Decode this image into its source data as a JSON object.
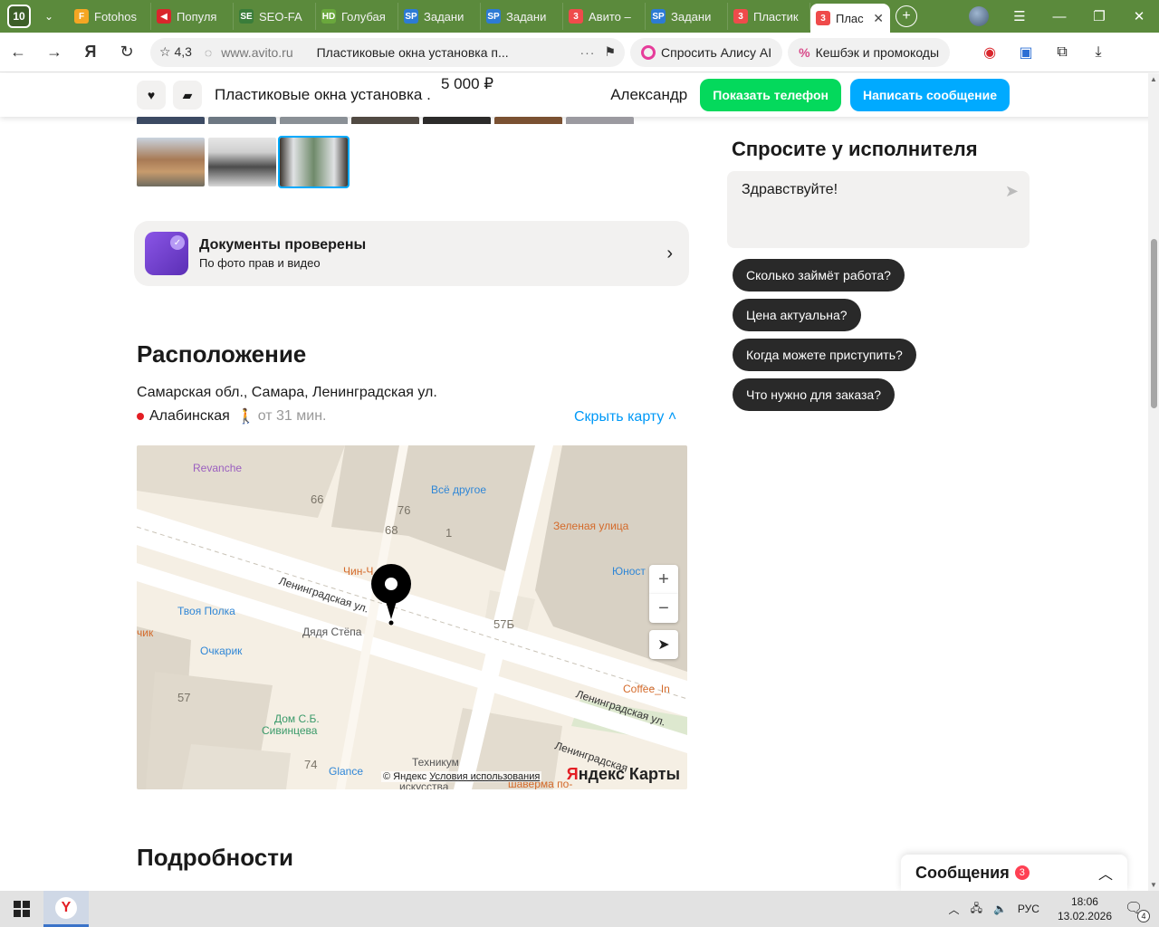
{
  "browser": {
    "tab_counter": "10",
    "tabs": [
      {
        "title": "Fotohos",
        "icon": "F",
        "color": "#f5a623"
      },
      {
        "title": "Популя",
        "icon": "◀",
        "color": "#d9262c"
      },
      {
        "title": "SEO-FA",
        "icon": "SE",
        "color": "#3a7d3a"
      },
      {
        "title": "Голубая",
        "icon": "HD",
        "color": "#6aa83c"
      },
      {
        "title": "Задани",
        "icon": "SP",
        "color": "#2d7bd4"
      },
      {
        "title": "Задани",
        "icon": "SP",
        "color": "#2d7bd4"
      },
      {
        "title": "Авито –",
        "icon": "3",
        "color": "#ef4b4b"
      },
      {
        "title": "Задани",
        "icon": "SP",
        "color": "#2d7bd4"
      },
      {
        "title": "Пластик",
        "icon": "3",
        "color": "#ef4b4b"
      }
    ],
    "active_tab": {
      "title": "Плас",
      "icon": "3",
      "color": "#ef4b4b"
    },
    "rating": "4,3",
    "domain": "www.avito.ru",
    "page_title": "Пластиковые окна установка п...",
    "alice_label": "Спросить Алису AI",
    "cashback_label": "Кешбэк и промокоды"
  },
  "sticky": {
    "title": "Пластиковые окна установка ...",
    "price": "5 000 ₽",
    "seller": "Александр",
    "show_phone": "Показать телефон",
    "write_message": "Написать сообщение"
  },
  "docs": {
    "title": "Документы проверены",
    "subtitle": "По фото прав и видео"
  },
  "location": {
    "heading": "Расположение",
    "address": "Самарская обл., Самара, Ленинградская ул.",
    "metro": "Алабинская",
    "walk": "от 31 мин.",
    "hide_map": "Скрыть карту"
  },
  "map": {
    "labels": [
      {
        "text": "Revanche",
        "color": "#9b5fc0"
      },
      {
        "text": "Всё другое",
        "color": "#2f86d6"
      },
      {
        "text": "Зеленая улица",
        "color": "#d46a2a"
      },
      {
        "text": "Юност",
        "color": "#2f86d6"
      },
      {
        "text": "Чин-Ч",
        "color": "#d46a2a"
      },
      {
        "text": "Ленинградская ул.",
        "color": "#333"
      },
      {
        "text": "Твоя Полка",
        "color": "#2f86d6"
      },
      {
        "text": "Очкарик",
        "color": "#2f86d6"
      },
      {
        "text": "Дядя Стёпа",
        "color": "#555"
      },
      {
        "text": "чик",
        "color": "#d46a2a"
      },
      {
        "text": "Coffee_In",
        "color": "#d46a2a"
      },
      {
        "text": "Ленинградская ул.",
        "color": "#333"
      },
      {
        "text": "Ленинградская",
        "color": "#333"
      },
      {
        "text": "Дом С.Б.",
        "color": "#3a9a6a"
      },
      {
        "text": "Сивинцева",
        "color": "#3a9a6a"
      },
      {
        "text": "Glance",
        "color": "#2f86d6"
      },
      {
        "text": "Техникум",
        "color": "#555"
      },
      {
        "text": "искусства",
        "color": "#555"
      },
      {
        "text": "шаверма по-",
        "color": "#d46a2a"
      }
    ],
    "house_numbers": [
      "66",
      "76",
      "68",
      "1",
      "57Б",
      "57",
      "74"
    ],
    "copyright": "© Яндекс",
    "terms": "Условия использования",
    "logo_red": "Я",
    "logo_rest": "ндекс Карты",
    "zoom_in": "+",
    "zoom_out": "−"
  },
  "details": {
    "heading": "Подробности"
  },
  "ask": {
    "title": "Спросите у исполнителя",
    "message": "Здравствуйте!",
    "chips": [
      "Сколько займёт работа?",
      "Цена актуальна?",
      "Когда можете приступить?",
      "Что нужно для заказа?"
    ]
  },
  "messages": {
    "label": "Сообщения",
    "count": "3"
  },
  "taskbar": {
    "lang": "РУС",
    "time": "18:06",
    "date": "13.02.2026",
    "notifications": "4"
  }
}
